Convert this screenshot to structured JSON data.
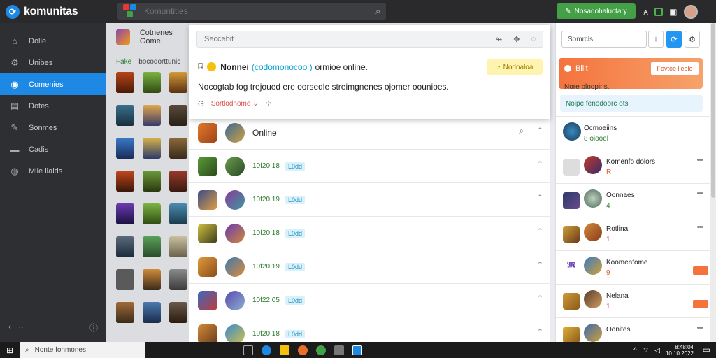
{
  "app": {
    "name": "komunitas"
  },
  "topbar": {
    "search_placeholder": "Komuntities",
    "cta_label": "Nosadohaluctary",
    "icons": [
      "bell-icon",
      "chat-icon",
      "avatar"
    ]
  },
  "sidebar": {
    "items": [
      {
        "label": "Dolle",
        "icon": "home-icon",
        "active": false
      },
      {
        "label": "Unibes",
        "icon": "gear-icon",
        "active": false
      },
      {
        "label": "Comenies",
        "icon": "compass-icon",
        "active": true
      },
      {
        "label": "Dotes",
        "icon": "list-icon",
        "active": false
      },
      {
        "label": "Sonmes",
        "icon": "wrench-icon",
        "active": false
      },
      {
        "label": "Cadis",
        "icon": "folder-icon",
        "active": false
      },
      {
        "label": "Mile liaids",
        "icon": "globe-icon",
        "active": false
      }
    ],
    "back_symbol": "‹",
    "more_symbol": "··",
    "info_symbol": "ⓘ"
  },
  "midcol": {
    "title": "Cotnenes Gome",
    "badge": "Fake",
    "subtitle": "bocodorttunic"
  },
  "panel": {
    "search_placeholder": "Seccebit",
    "title_prefix": "Nonnei",
    "title_highlight": "(codomonocoo )",
    "title_suffix": "ormioe online.",
    "badge_label": "Nodoaloa",
    "body": "Nocogtab fog trejoued ere oorsedle streimgnenes ojomer oounioes.",
    "footer_link": "Sortlodnome",
    "footer_link_suffix": "⌄"
  },
  "list": {
    "header": "Online",
    "rows": [
      {
        "time": "10f20 18",
        "tag": "L0dd"
      },
      {
        "time": "10f20 19",
        "tag": "L0dd"
      },
      {
        "time": "10f20 18",
        "tag": "L0dd"
      },
      {
        "time": "10f20 19",
        "tag": "L0dd"
      },
      {
        "time": "10f22 05",
        "tag": "L0dd"
      },
      {
        "time": "10f20 18",
        "tag": "L0dd"
      }
    ]
  },
  "right": {
    "search_placeholder": "Somrcls",
    "card_title": "Bilit",
    "card_button": "Fovtoe lleole",
    "note": "Nore bloopiris.",
    "info": "Noipe fenodoorc ots",
    "rows": [
      {
        "name": "Ocmoeiins",
        "count": "8 oiooel",
        "count_color": "green"
      },
      {
        "name": "Komenfo dolors",
        "count": "R",
        "count_color": "orange"
      },
      {
        "name": "Oonnaes",
        "count": "4",
        "count_color": "green"
      },
      {
        "name": "Rotlina",
        "count": "1",
        "count_color": "orange"
      },
      {
        "name": "Koomenfome",
        "count": "9",
        "count_color": "orange"
      },
      {
        "name": "Nelana",
        "count": "1",
        "count_color": "orange"
      },
      {
        "name": "Oonites",
        "count": "",
        "count_color": "orange"
      }
    ]
  },
  "taskbar": {
    "search_placeholder": "Nonte fonmones",
    "clock_time": "8:48:04",
    "clock_date": "10 10 2022"
  },
  "colors": {
    "accent": "#1e88e5",
    "cta": "#43a047",
    "orange": "#f4733d"
  }
}
